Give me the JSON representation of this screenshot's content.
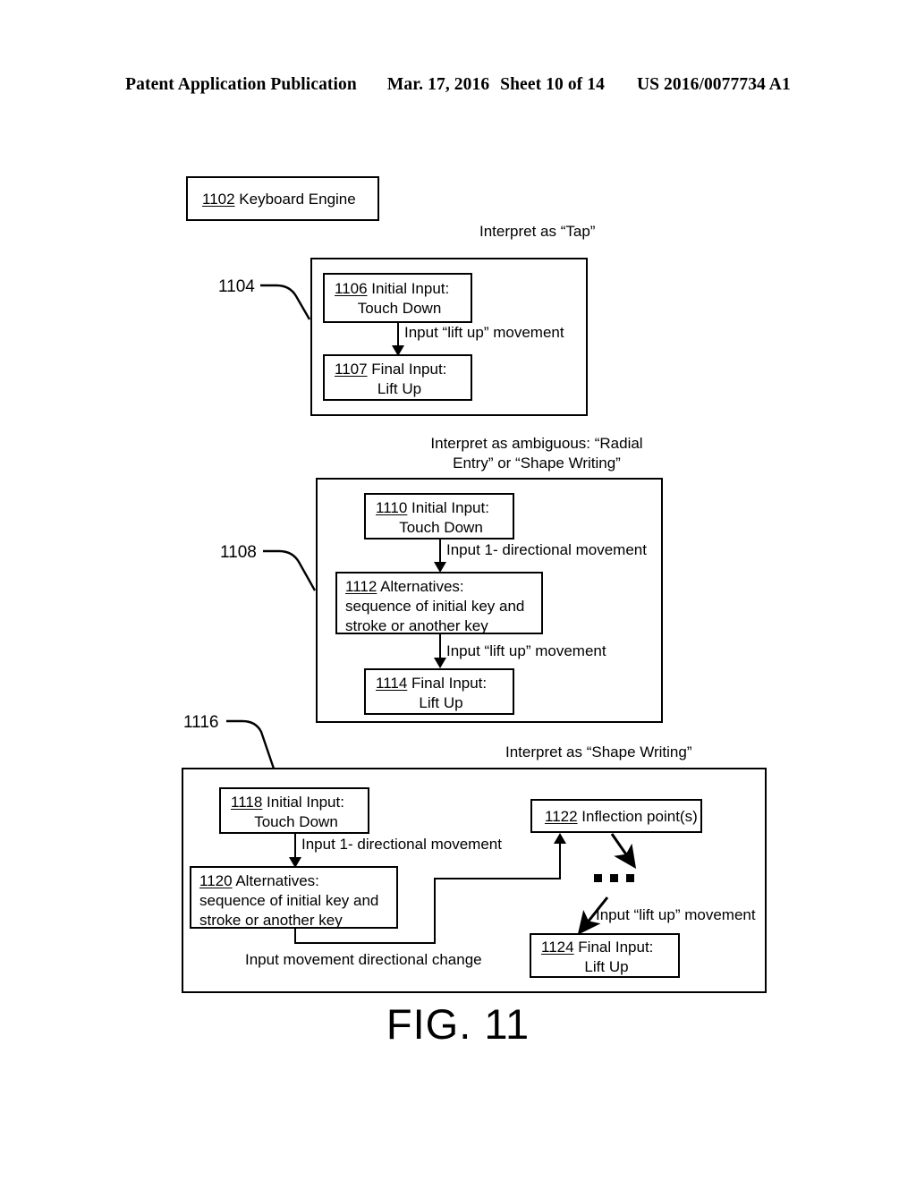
{
  "header": {
    "publication": "Patent Application Publication",
    "date": "Mar. 17, 2016",
    "sheet": "Sheet 10 of 14",
    "patent_number": "US 2016/0077734 A1"
  },
  "figure": {
    "caption": "FIG. 11"
  },
  "nodes": {
    "keyboard_engine": {
      "ref": "1102",
      "text": " Keyboard Engine"
    },
    "n1106": {
      "ref": "1106",
      "line1": " Initial Input:",
      "line2": "Touch Down"
    },
    "n1107": {
      "ref": "1107",
      "line1": " Final Input:",
      "line2": "Lift Up"
    },
    "n1110": {
      "ref": "1110",
      "line1": " Initial Input:",
      "line2": "Touch Down"
    },
    "n1112": {
      "ref": "1112",
      "line1": " Alternatives:",
      "line2": "sequence of initial key and",
      "line3": "stroke or another key"
    },
    "n1114": {
      "ref": "1114",
      "line1": " Final Input:",
      "line2": "Lift Up"
    },
    "n1118": {
      "ref": "1118",
      "line1": " Initial Input:",
      "line2": "Touch Down"
    },
    "n1120": {
      "ref": "1120",
      "line1": " Alternatives:",
      "line2": "sequence of initial key and",
      "line3": "stroke or another key"
    },
    "n1122": {
      "ref": "1122",
      "line1": " Inflection point(s)"
    },
    "n1124": {
      "ref": "1124",
      "line1": " Final Input:",
      "line2": "Lift Up"
    }
  },
  "groups": {
    "g1104": {
      "ref": "1104"
    },
    "g1108": {
      "ref": "1108"
    },
    "g1116": {
      "ref": "1116"
    }
  },
  "annotations": {
    "interpret_tap": "Interpret as “Tap”",
    "interpret_ambiguous_l1": "Interpret as ambiguous: “Radial",
    "interpret_ambiguous_l2": "Entry” or “Shape Writing”",
    "interpret_shape_writing": "Interpret as “Shape Writing”",
    "lift_up_movement_1104": "Input “lift up” movement",
    "lift_up_movement_1108": "Input “lift up” movement",
    "lift_up_movement_1116": "Input “lift up” movement",
    "directional_movement_1108": "Input 1- directional movement",
    "directional_movement_1116": "Input 1- directional movement",
    "directional_change": "Input movement directional change"
  },
  "colors": {
    "ink": "#000000",
    "paper": "#ffffff"
  }
}
